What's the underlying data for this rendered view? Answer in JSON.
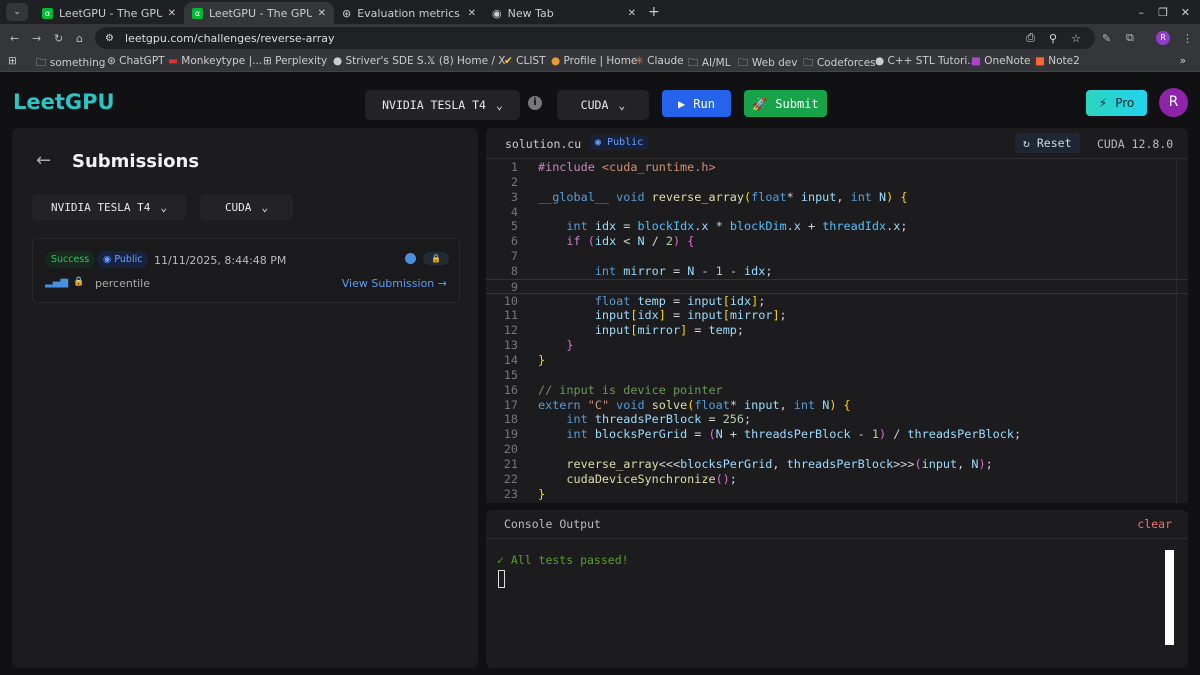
{
  "browser": {
    "tabs": [
      {
        "title": "LeetGPU - The GPU Prog",
        "active": false
      },
      {
        "title": "LeetGPU - The GPU Prog",
        "active": true
      },
      {
        "title": "Evaluation metrics expla",
        "active": false
      },
      {
        "title": "New Tab",
        "active": false
      }
    ],
    "url": "leetgpu.com/challenges/reverse-array",
    "profile_initial": "R",
    "bookmarks": [
      "something",
      "ChatGPT",
      "Monkeytype |...",
      "Perplexity",
      "Striver's SDE S...",
      "(8) Home / X",
      "CLIST",
      "Profile | Home",
      "Claude",
      "AI/ML",
      "Web dev",
      "Codeforces",
      "C++ STL Tutori...",
      "OneNote",
      "Note2"
    ]
  },
  "header": {
    "logo": "LeetGPU",
    "gpu": "NVIDIA TESLA T4",
    "language": "CUDA",
    "run": "Run",
    "submit": "Submit",
    "pro": "Pro",
    "avatar": "R"
  },
  "submissions": {
    "title": "Submissions",
    "gpu": "NVIDIA TESLA T4",
    "language": "CUDA",
    "items": [
      {
        "status": "Success",
        "visibility": "Public",
        "timestamp": "11/11/2025, 8:44:48 PM",
        "percentile": "percentile",
        "link": "View Submission →"
      }
    ]
  },
  "editor": {
    "filename": "solution.cu",
    "visibility": "Public",
    "reset": "Reset",
    "version": "CUDA 12.8.0",
    "current_line": 9,
    "lines": [
      [
        [
          "m",
          "#include "
        ],
        [
          "s",
          "<cuda_runtime.h>"
        ]
      ],
      [],
      [
        [
          "k",
          "__global__"
        ],
        [
          "d",
          " "
        ],
        [
          "k",
          "void"
        ],
        [
          "d",
          " "
        ],
        [
          "f",
          "reverse_array"
        ],
        [
          "b1",
          "("
        ],
        [
          "k",
          "float"
        ],
        [
          "d",
          "* "
        ],
        [
          "v",
          "input"
        ],
        [
          "d",
          ", "
        ],
        [
          "k",
          "int"
        ],
        [
          "d",
          " "
        ],
        [
          "v",
          "N"
        ],
        [
          "b1",
          ")"
        ],
        [
          "d",
          " "
        ],
        [
          "b1",
          "{"
        ]
      ],
      [],
      [
        [
          "d",
          "    "
        ],
        [
          "k",
          "int"
        ],
        [
          "d",
          " "
        ],
        [
          "v",
          "idx"
        ],
        [
          "d",
          " = "
        ],
        [
          "bi",
          "blockIdx"
        ],
        [
          "d",
          "."
        ],
        [
          "v",
          "x"
        ],
        [
          "d",
          " * "
        ],
        [
          "bi",
          "blockDim"
        ],
        [
          "d",
          "."
        ],
        [
          "v",
          "x"
        ],
        [
          "d",
          " + "
        ],
        [
          "bi",
          "threadIdx"
        ],
        [
          "d",
          "."
        ],
        [
          "v",
          "x"
        ],
        [
          "d",
          ";"
        ]
      ],
      [
        [
          "d",
          "    "
        ],
        [
          "m",
          "if"
        ],
        [
          "d",
          " "
        ],
        [
          "b2",
          "("
        ],
        [
          "v",
          "idx"
        ],
        [
          "d",
          " < "
        ],
        [
          "v",
          "N"
        ],
        [
          "d",
          " / "
        ],
        [
          "n",
          "2"
        ],
        [
          "b2",
          ")"
        ],
        [
          "d",
          " "
        ],
        [
          "b2",
          "{"
        ]
      ],
      [],
      [
        [
          "d",
          "        "
        ],
        [
          "k",
          "int"
        ],
        [
          "d",
          " "
        ],
        [
          "v",
          "mirror"
        ],
        [
          "d",
          " = "
        ],
        [
          "v",
          "N"
        ],
        [
          "d",
          " - "
        ],
        [
          "n",
          "1"
        ],
        [
          "d",
          " - "
        ],
        [
          "v",
          "idx"
        ],
        [
          "d",
          ";"
        ]
      ],
      [],
      [
        [
          "d",
          "        "
        ],
        [
          "k",
          "float"
        ],
        [
          "d",
          " "
        ],
        [
          "v",
          "temp"
        ],
        [
          "d",
          " = "
        ],
        [
          "v",
          "input"
        ],
        [
          "b1",
          "["
        ],
        [
          "v",
          "idx"
        ],
        [
          "b1",
          "]"
        ],
        [
          "d",
          ";"
        ]
      ],
      [
        [
          "d",
          "        "
        ],
        [
          "v",
          "input"
        ],
        [
          "b1",
          "["
        ],
        [
          "v",
          "idx"
        ],
        [
          "b1",
          "]"
        ],
        [
          "d",
          " = "
        ],
        [
          "v",
          "input"
        ],
        [
          "b1",
          "["
        ],
        [
          "v",
          "mirror"
        ],
        [
          "b1",
          "]"
        ],
        [
          "d",
          ";"
        ]
      ],
      [
        [
          "d",
          "        "
        ],
        [
          "v",
          "input"
        ],
        [
          "b1",
          "["
        ],
        [
          "v",
          "mirror"
        ],
        [
          "b1",
          "]"
        ],
        [
          "d",
          " = "
        ],
        [
          "v",
          "temp"
        ],
        [
          "d",
          ";"
        ]
      ],
      [
        [
          "d",
          "    "
        ],
        [
          "b2",
          "}"
        ]
      ],
      [
        [
          "b1",
          "}"
        ]
      ],
      [],
      [
        [
          "c",
          "// input is device pointer"
        ]
      ],
      [
        [
          "k",
          "extern"
        ],
        [
          "d",
          " "
        ],
        [
          "s",
          "\"C\""
        ],
        [
          "d",
          " "
        ],
        [
          "k",
          "void"
        ],
        [
          "d",
          " "
        ],
        [
          "f",
          "solve"
        ],
        [
          "b1",
          "("
        ],
        [
          "k",
          "float"
        ],
        [
          "d",
          "* "
        ],
        [
          "v",
          "input"
        ],
        [
          "d",
          ", "
        ],
        [
          "k",
          "int"
        ],
        [
          "d",
          " "
        ],
        [
          "v",
          "N"
        ],
        [
          "b1",
          ")"
        ],
        [
          "d",
          " "
        ],
        [
          "b1",
          "{"
        ]
      ],
      [
        [
          "d",
          "    "
        ],
        [
          "k",
          "int"
        ],
        [
          "d",
          " "
        ],
        [
          "v",
          "threadsPerBlock"
        ],
        [
          "d",
          " = "
        ],
        [
          "n",
          "256"
        ],
        [
          "d",
          ";"
        ]
      ],
      [
        [
          "d",
          "    "
        ],
        [
          "k",
          "int"
        ],
        [
          "d",
          " "
        ],
        [
          "v",
          "blocksPerGrid"
        ],
        [
          "d",
          " = "
        ],
        [
          "b2",
          "("
        ],
        [
          "v",
          "N"
        ],
        [
          "d",
          " + "
        ],
        [
          "v",
          "threadsPerBlock"
        ],
        [
          "d",
          " - "
        ],
        [
          "n",
          "1"
        ],
        [
          "b2",
          ")"
        ],
        [
          "d",
          " / "
        ],
        [
          "v",
          "threadsPerBlock"
        ],
        [
          "d",
          ";"
        ]
      ],
      [],
      [
        [
          "d",
          "    "
        ],
        [
          "f",
          "reverse_array"
        ],
        [
          "d",
          "<<<"
        ],
        [
          "v",
          "blocksPerGrid"
        ],
        [
          "d",
          ", "
        ],
        [
          "v",
          "threadsPerBlock"
        ],
        [
          "d",
          ">>>"
        ],
        [
          "b2",
          "("
        ],
        [
          "v",
          "input"
        ],
        [
          "d",
          ", "
        ],
        [
          "v",
          "N"
        ],
        [
          "b2",
          ")"
        ],
        [
          "d",
          ";"
        ]
      ],
      [
        [
          "d",
          "    "
        ],
        [
          "f",
          "cudaDeviceSynchronize"
        ],
        [
          "b2",
          "()"
        ],
        [
          "d",
          ";"
        ]
      ],
      [
        [
          "b1",
          "}"
        ]
      ]
    ]
  },
  "console": {
    "title": "Console Output",
    "clear": "clear",
    "output": "✓ All tests passed!"
  }
}
